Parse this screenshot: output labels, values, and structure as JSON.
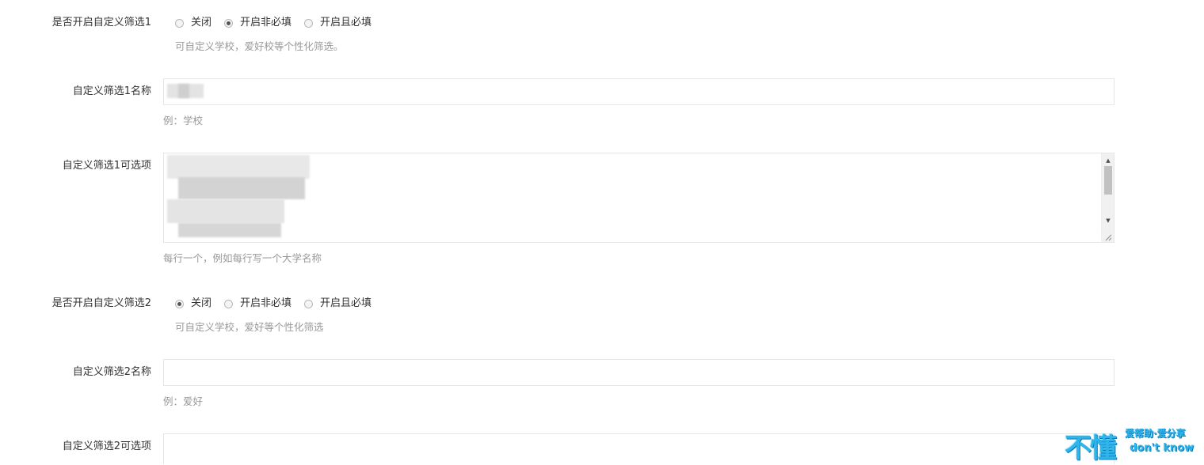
{
  "filter1": {
    "enable_label": "是否开启自定义筛选1",
    "options": [
      "关闭",
      "开启非必填",
      "开启且必填"
    ],
    "selected": "开启非必填",
    "enable_hint": "可自定义学校，爱好校等个性化筛选。",
    "name_label": "自定义筛选1名称",
    "name_value": "",
    "name_hint": "例：学校",
    "options_label": "自定义筛选1可选项",
    "options_hint": "每行一个，例如每行写一个大学名称"
  },
  "filter2": {
    "enable_label": "是否开启自定义筛选2",
    "options": [
      "关闭",
      "开启非必填",
      "开启且必填"
    ],
    "selected": "关闭",
    "enable_hint": "可自定义学校，爱好等个性化筛选",
    "name_label": "自定义筛选2名称",
    "name_value": "",
    "name_hint": "例：爱好",
    "options_label": "自定义筛选2可选项"
  },
  "watermark": {
    "big": "不懂",
    "top": "爱帮助·爱分享",
    "bottom": "don't know"
  },
  "colors": {
    "label": "#333333",
    "hint": "#999999",
    "border": "#e6e6e6",
    "watermark": "#2fb5ea"
  }
}
